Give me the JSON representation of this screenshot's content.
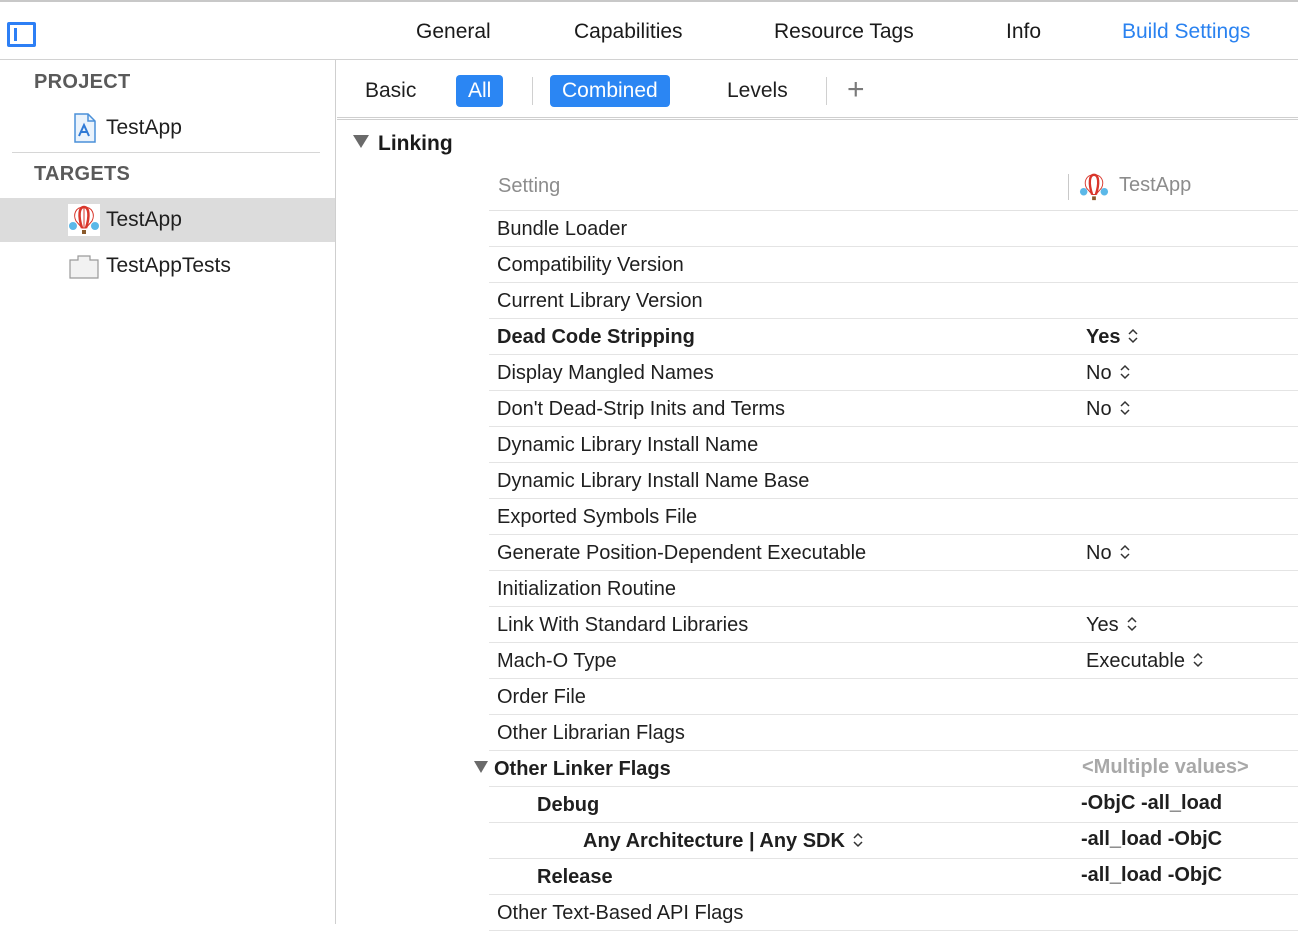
{
  "tabs": {
    "items": [
      "General",
      "Capabilities",
      "Resource Tags",
      "Info",
      "Build Settings"
    ],
    "active": "Build Settings"
  },
  "sidebar": {
    "project_header": "PROJECT",
    "project_item": "TestApp",
    "targets_header": "TARGETS",
    "target_items": [
      "TestApp",
      "TestAppTests"
    ]
  },
  "filter": {
    "basic": "Basic",
    "all": "All",
    "combined": "Combined",
    "levels": "Levels",
    "add": "+"
  },
  "section": {
    "title": "Linking",
    "setting_column": "Setting",
    "target_column": "TestApp"
  },
  "rows": [
    {
      "name": "Bundle Loader",
      "value": ""
    },
    {
      "name": "Compatibility Version",
      "value": ""
    },
    {
      "name": "Current Library Version",
      "value": ""
    },
    {
      "name": "Dead Code Stripping",
      "value": "Yes"
    },
    {
      "name": "Display Mangled Names",
      "value": "No"
    },
    {
      "name": "Don't Dead-Strip Inits and Terms",
      "value": "No"
    },
    {
      "name": "Dynamic Library Install Name",
      "value": ""
    },
    {
      "name": "Dynamic Library Install Name Base",
      "value": ""
    },
    {
      "name": "Exported Symbols File",
      "value": ""
    },
    {
      "name": "Generate Position-Dependent Executable",
      "value": "No"
    },
    {
      "name": "Initialization Routine",
      "value": ""
    },
    {
      "name": "Link With Standard Libraries",
      "value": "Yes"
    },
    {
      "name": "Mach-O Type",
      "value": "Executable"
    },
    {
      "name": "Order File",
      "value": ""
    },
    {
      "name": "Other Librarian Flags",
      "value": ""
    },
    {
      "name": "Other Linker Flags",
      "value": "<Multiple values>"
    },
    {
      "name": "Debug",
      "value": "-ObjC -all_load"
    },
    {
      "name": "Any Architecture | Any SDK",
      "value": "-all_load -ObjC"
    },
    {
      "name": "Release",
      "value": "-all_load -ObjC"
    },
    {
      "name": "Other Text-Based API Flags",
      "value": ""
    }
  ],
  "colors": {
    "accent": "#2b86f3",
    "selected_row": "#dcdcdc"
  }
}
